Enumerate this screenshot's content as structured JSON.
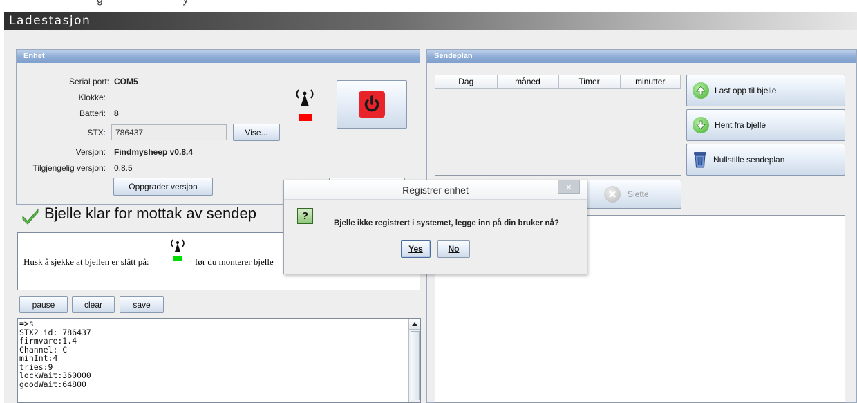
{
  "top_cut_text": "g                          y",
  "window": {
    "title": "Ladestasjon"
  },
  "enhet": {
    "header": "Enhet",
    "serial_port_label": "Serial port:",
    "serial_port_value": "COM5",
    "klokke_label": "Klokke:",
    "batteri_label": "Batteri:",
    "batteri_value": "8",
    "stx_label": "STX:",
    "stx_value": "786437",
    "vise_button": "Vise...",
    "versjon_label": "Versjon:",
    "versjon_value": "Findmysheep v0.8.4",
    "tilgjengelig_label": "Tilgjengelig versjon:",
    "tilgjengelig_value": "0.8.5",
    "upgrade_button": "Oppgrader versjon",
    "antenna_color": "#ff0000",
    "power_color": "#e8242a"
  },
  "status": {
    "message": "Bjelle klar for mottak av sendep",
    "hint_before": "Husk å sjekke at bjellen er slått på:",
    "hint_after": "før du monterer bjelle",
    "antenna_color": "#00dd00"
  },
  "log": {
    "pause_button": "pause",
    "clear_button": "clear",
    "save_button": "save",
    "lines": [
      "=>s",
      "STX2 id: 786437",
      "firmvare:1.4",
      "Channel: C",
      "minInt:4",
      "tries:9",
      "lockWait:360000",
      "goodWait:64800"
    ]
  },
  "sendeplan": {
    "header": "Sendeplan",
    "columns": [
      "Dag",
      "måned",
      "Timer",
      "minutter"
    ],
    "upload_button": "Last opp til bjelle",
    "fetch_button": "Hent fra bjelle",
    "reset_button": "Nullstille sendeplan",
    "delete_button": "Slette"
  },
  "dialog": {
    "title": "Registrer enhet",
    "close_symbol": "×",
    "question_mark": "?",
    "message": "Bjelle ikke registrert i systemet, legge inn på din bruker nå?",
    "yes_button": "Yes",
    "no_button": "No"
  }
}
